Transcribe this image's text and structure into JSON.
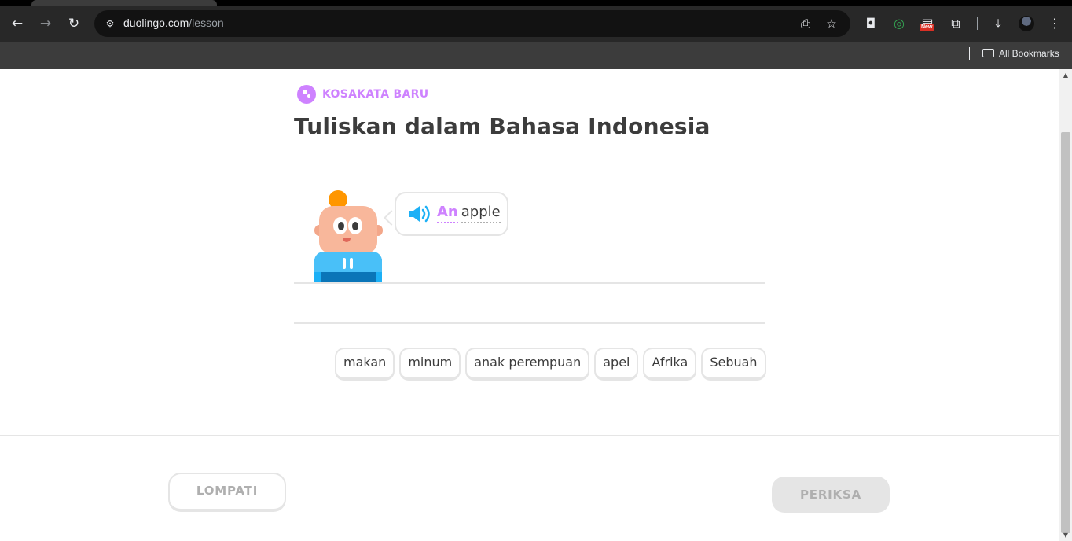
{
  "browser": {
    "url_domain": "duolingo.com",
    "url_path": "/lesson",
    "bookmarks_label": "All Bookmarks",
    "extension_badge": "New"
  },
  "lesson": {
    "badge_label": "KOSAKATA BARU",
    "title": "Tuliskan dalam Bahasa Indonesia",
    "prompt_words": [
      "An",
      "apple"
    ],
    "word_bank": [
      "makan",
      "minum",
      "anak perempuan",
      "apel",
      "Afrika",
      "Sebuah"
    ]
  },
  "footer": {
    "skip_label": "LOMPATI",
    "check_label": "PERIKSA"
  },
  "colors": {
    "accent_purple": "#ce82ff",
    "speaker_blue": "#1cb0f6",
    "text_dark": "#3c3c3c",
    "border_gray": "#e5e5e5",
    "disabled_text": "#afafaf"
  }
}
